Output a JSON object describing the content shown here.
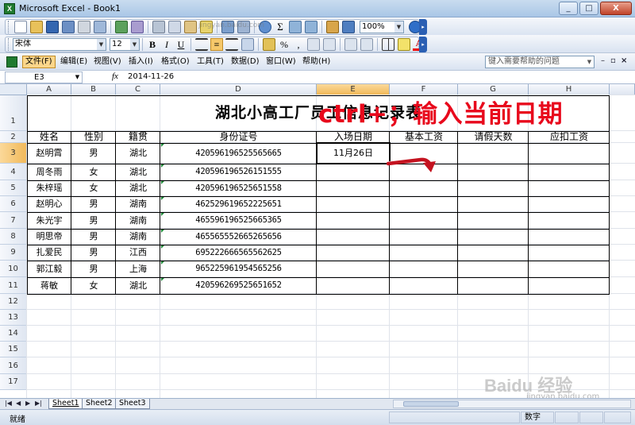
{
  "window": {
    "title": "Microsoft Excel - Book1",
    "close_label": "X",
    "min_label": "_",
    "max_label": "□"
  },
  "toolbar_standard": {
    "zoom": "100%",
    "sigma": "Σ",
    "url_ghost": "jingyan.baidu.com"
  },
  "toolbar_format": {
    "font_name": "宋体",
    "font_size": "12",
    "bold": "B",
    "italic": "I",
    "underline": "U",
    "percent": "%",
    "comma": ",",
    "font_color": "A"
  },
  "menubar": {
    "items": [
      "文件(F)",
      "编辑(E)",
      "视图(V)",
      "插入(I)",
      "格式(O)",
      "工具(T)",
      "数据(D)",
      "窗口(W)",
      "帮助(H)"
    ],
    "active_index": 0,
    "help_placeholder": "键入需要帮助的问题",
    "mdi_min": "–",
    "mdi_restore": "▫",
    "mdi_close": "×"
  },
  "formula_bar": {
    "name_box": "E3",
    "fx": "fx",
    "value": "2014-11-26"
  },
  "sheet": {
    "columns": [
      "A",
      "B",
      "C",
      "D",
      "E",
      "F",
      "G",
      "H"
    ],
    "selected_column": "E",
    "rows": [
      "1",
      "2",
      "3",
      "4",
      "5",
      "6",
      "7",
      "8",
      "9",
      "10",
      "11",
      "12",
      "13",
      "14",
      "15",
      "16",
      "17"
    ],
    "selected_row": "3",
    "title": "湖北小高工厂员工信息记录表",
    "headers": [
      "姓名",
      "性别",
      "籍贯",
      "身份证号",
      "入场日期",
      "基本工资",
      "请假天数",
      "应扣工资"
    ],
    "records": [
      [
        "赵明霄",
        "男",
        "湖北",
        "420596196525565665",
        "11月26日"
      ],
      [
        "周冬雨",
        "女",
        "湖北",
        "420596196526151555",
        ""
      ],
      [
        "朱梓瑶",
        "女",
        "湖北",
        "420596196525651558",
        ""
      ],
      [
        "赵明心",
        "男",
        "湖南",
        "462529619652225651",
        ""
      ],
      [
        "朱光宇",
        "男",
        "湖南",
        "465596196525665365",
        ""
      ],
      [
        "明思帝",
        "男",
        "湖南",
        "465565552665265656",
        ""
      ],
      [
        "扎爱民",
        "男",
        "江西",
        "695222666565562625",
        ""
      ],
      [
        "郭江毅",
        "男",
        "上海",
        "965225961954565256",
        ""
      ],
      [
        "蒋敏",
        "女",
        "湖北",
        "420596269525651652",
        ""
      ]
    ]
  },
  "annotation": {
    "text": "ctrl+；输入当前日期",
    "color": "#e8091c"
  },
  "sheet_tabs": {
    "nav": [
      "|◀",
      "◀",
      "▶",
      "▶|"
    ],
    "tabs": [
      "Sheet1",
      "Sheet2",
      "Sheet3"
    ],
    "active_index": 0
  },
  "status_bar": {
    "left": "就绪",
    "mode": "数字"
  },
  "watermark": {
    "logo": "Baidu 经验",
    "url": "jingyan.baidu.com"
  }
}
